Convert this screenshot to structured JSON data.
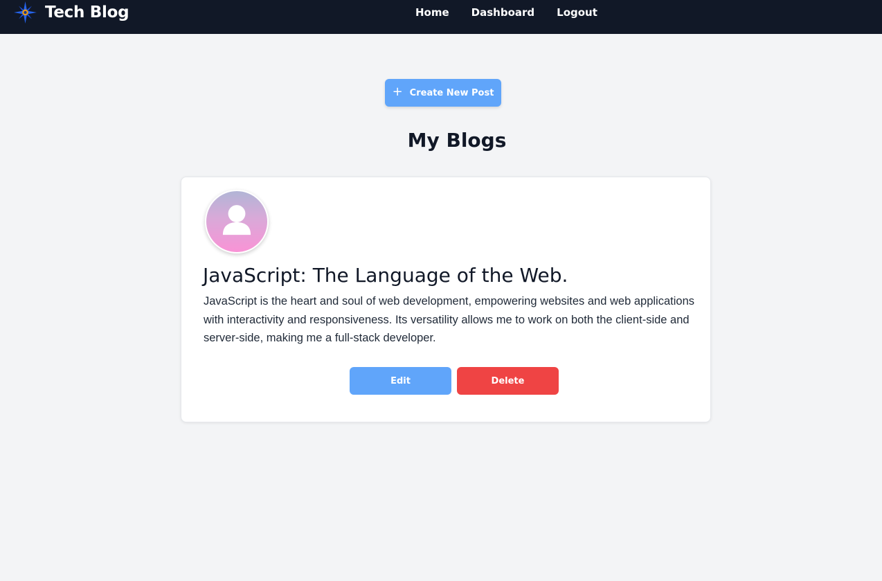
{
  "header": {
    "brand_name": "Tech Blog",
    "logo_icon": "compass-star-icon",
    "nav": [
      {
        "label": "Home"
      },
      {
        "label": "Dashboard"
      },
      {
        "label": "Logout"
      }
    ]
  },
  "main": {
    "create_button_label": "Create New Post",
    "create_button_icon": "plus-icon",
    "page_title": "My Blogs",
    "posts": [
      {
        "avatar_icon": "user-avatar-icon",
        "title": "JavaScript: The Language of the Web.",
        "body": "JavaScript is the heart and soul of web development, empowering websites and web applications with interactivity and responsiveness. Its versatility allows me to work on both the client-side and server-side, making me a full-stack developer.",
        "edit_label": "Edit",
        "delete_label": "Delete"
      }
    ]
  },
  "colors": {
    "navbar_bg": "#111827",
    "page_bg": "#f3f4f6",
    "primary_button": "#60a5fa",
    "danger_button": "#ef4444"
  }
}
